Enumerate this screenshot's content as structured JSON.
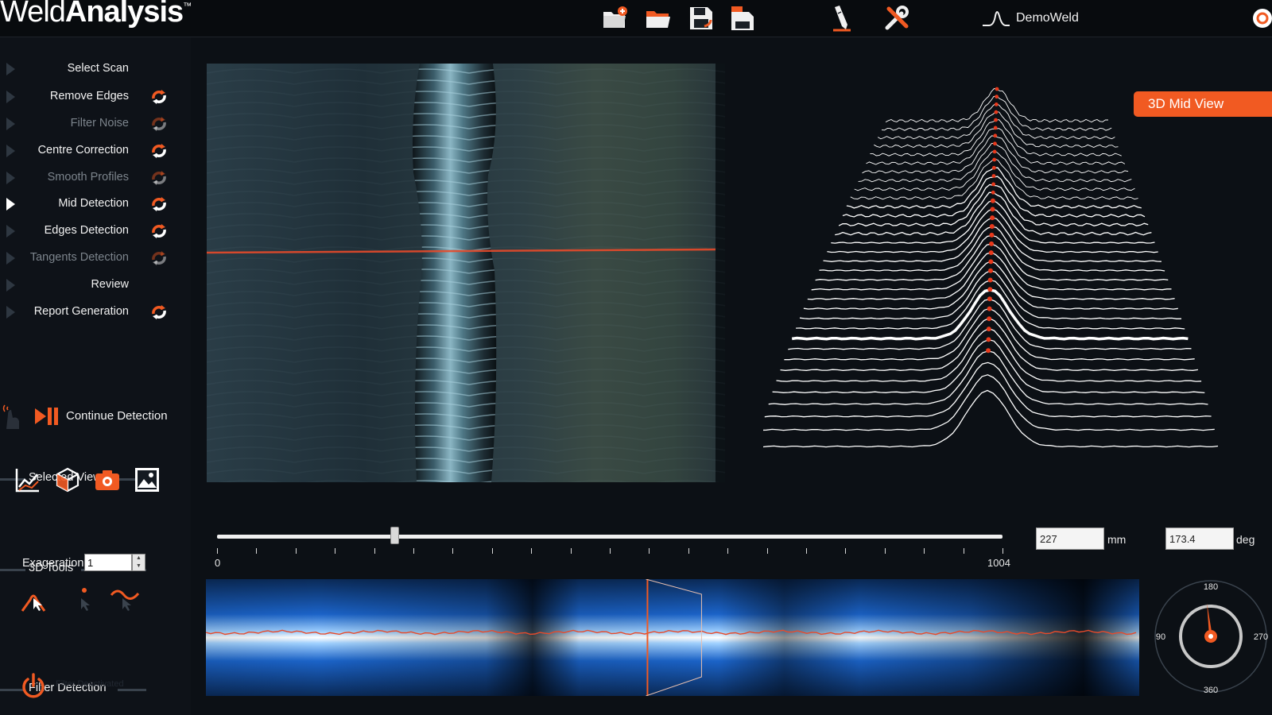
{
  "app": {
    "logo_prefix": "Weld",
    "logo_bold": "Analysis",
    "logo_tm": "™",
    "project_name": "DemoWeld"
  },
  "toolbar": {
    "icons": [
      "new-folder-icon",
      "open-folder-icon",
      "save-icon",
      "save-as-icon",
      "edit-pencil-icon",
      "tools-icon",
      "waveform-icon",
      "refresh-icon"
    ]
  },
  "steps": [
    {
      "label": "Select Scan",
      "dim": false,
      "redo": false,
      "active": false
    },
    {
      "label": "Remove Edges",
      "dim": false,
      "redo": true,
      "active": false
    },
    {
      "label": "Filter Noise",
      "dim": true,
      "redo": true,
      "active": false
    },
    {
      "label": "Centre Correction",
      "dim": false,
      "redo": true,
      "active": false
    },
    {
      "label": "Smooth Profiles",
      "dim": true,
      "redo": true,
      "active": false
    },
    {
      "label": "Mid Detection",
      "dim": false,
      "redo": true,
      "active": true
    },
    {
      "label": "Edges Detection",
      "dim": false,
      "redo": true,
      "active": false
    },
    {
      "label": "Tangents Detection",
      "dim": true,
      "redo": true,
      "active": false
    },
    {
      "label": "Review",
      "dim": false,
      "redo": false,
      "active": false
    },
    {
      "label": "Report Generation",
      "dim": false,
      "redo": true,
      "active": false
    }
  ],
  "detection": {
    "continue_label": "Continue Detection"
  },
  "selected_views": {
    "title": "Selected Views",
    "icons": [
      "line-chart-icon",
      "3d-cube-icon",
      "camera-icon",
      "image-icon"
    ]
  },
  "tools_3d": {
    "title": "3D Tools",
    "exaggeration_label": "Exageration",
    "exaggeration_value": "1",
    "icons": [
      "peak-tool-icon",
      "point-tool-icon",
      "curve-tool-icon"
    ]
  },
  "filter_detection": {
    "title": "Filter Detection",
    "status_text": "Filter Deactivated"
  },
  "view_3d": {
    "button_label": "3D Mid View",
    "profile_count": 34,
    "highlighted_profile_index": 9
  },
  "slider": {
    "min_label": "0",
    "max_label": "1004",
    "position": 227,
    "tick_count": 21
  },
  "position_mm": {
    "value": "227",
    "unit": "mm"
  },
  "angle_deg": {
    "value": "173.4",
    "unit": "deg"
  },
  "compass": {
    "top_label": "180",
    "left_label": "90",
    "right_label": "270",
    "bottom_label": "360",
    "angle": 173.4
  },
  "colors": {
    "accent": "#f15a22",
    "background": "#0c1015",
    "laser_line": "#e84a2a",
    "scan_blue": "#1b63c8"
  }
}
